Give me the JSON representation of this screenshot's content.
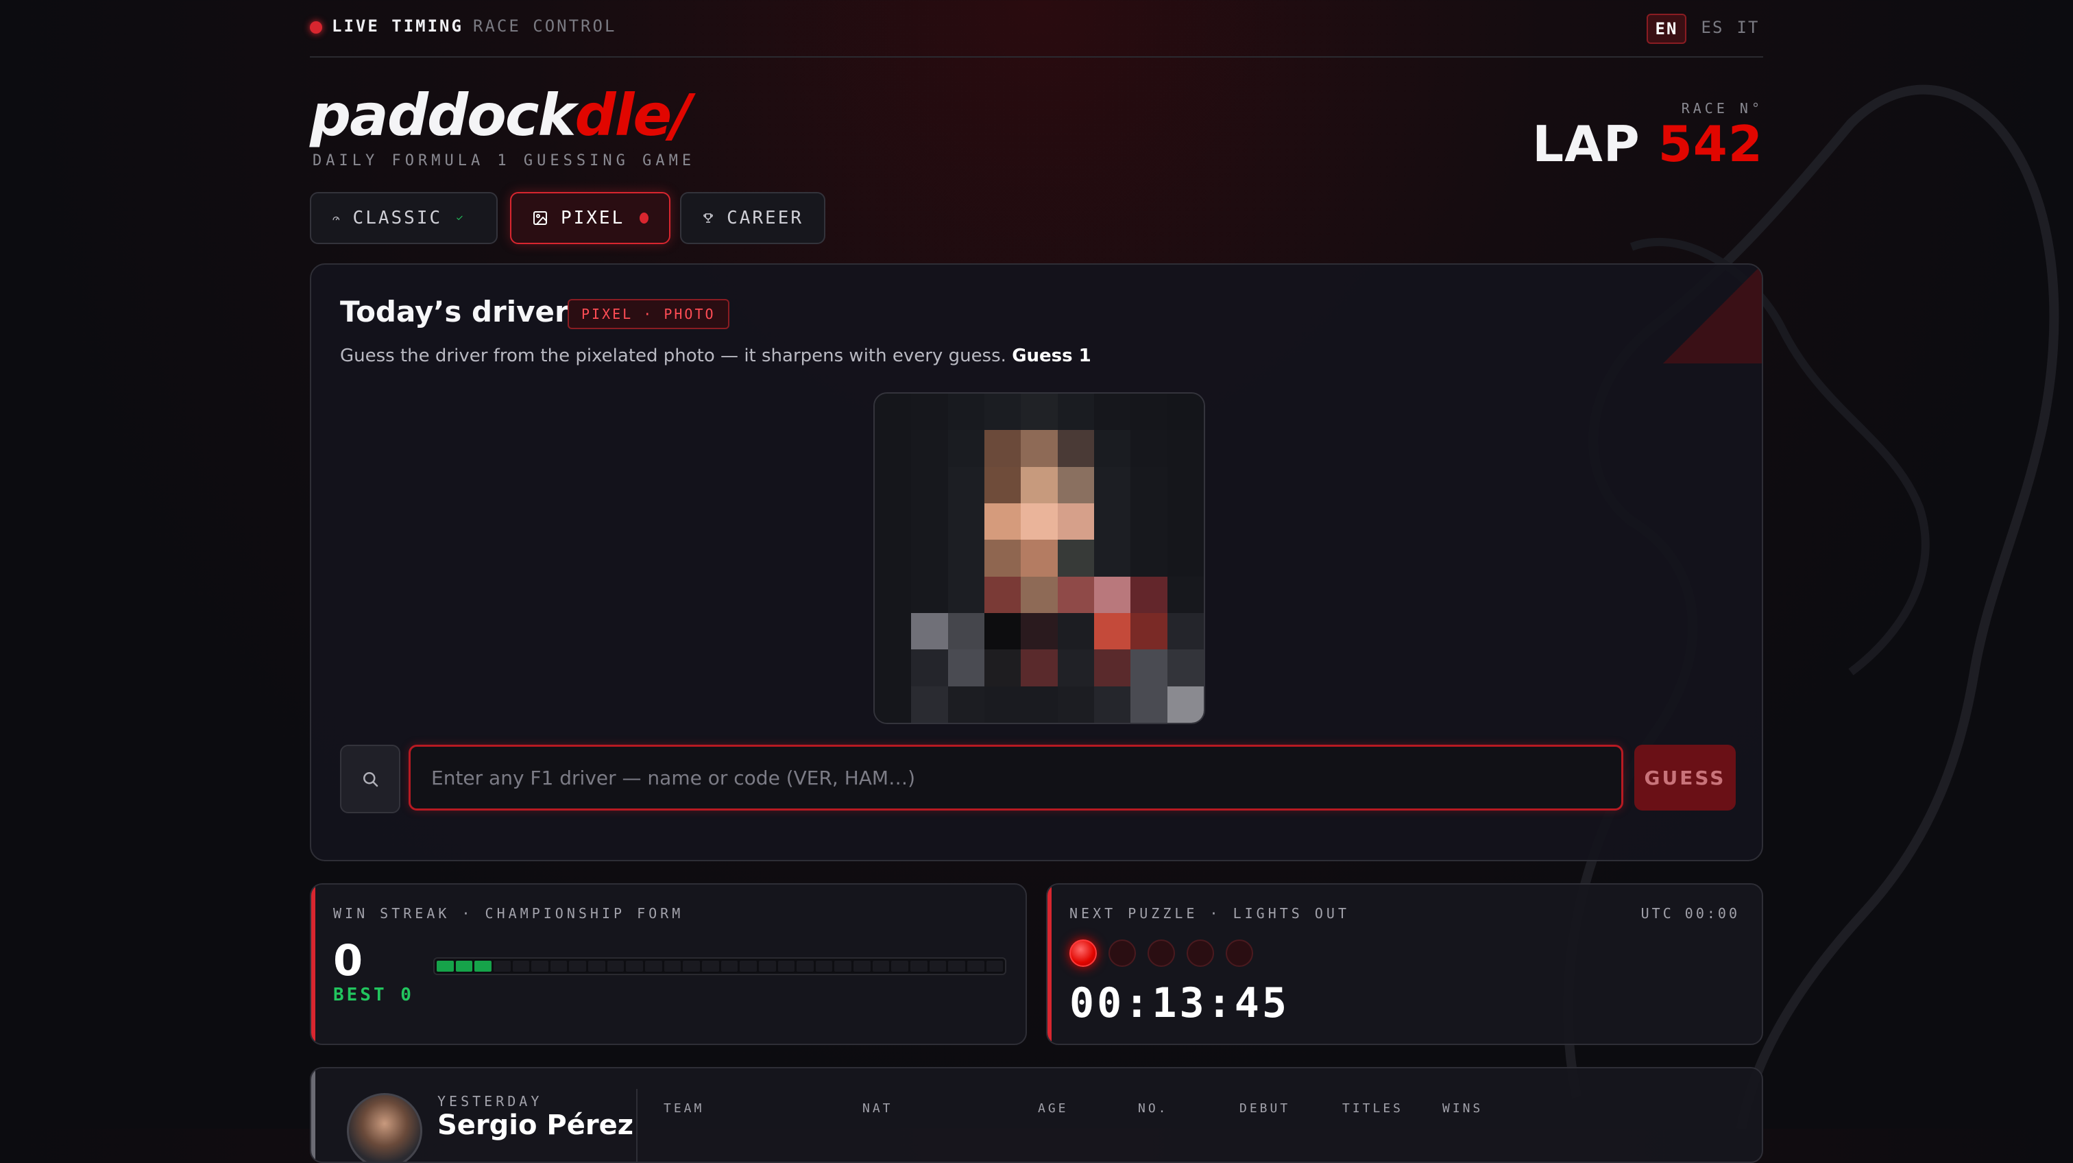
{
  "topbar": {
    "live_label": "LIVE TIMING",
    "race_control_label": "RACE CONTROL",
    "languages": [
      {
        "code": "EN",
        "active": true
      },
      {
        "code": "ES",
        "active": false
      },
      {
        "code": "IT",
        "active": false
      }
    ]
  },
  "header": {
    "logo_main": "paddock",
    "logo_accent": "dle",
    "logo_mark": "/",
    "tagline": "DAILY FORMULA 1 GUESSING GAME",
    "race_label": "RACE N°",
    "lap_label": "LAP",
    "lap_number": "542"
  },
  "tabs": [
    {
      "label": "CLASSIC",
      "icon": "speedometer-icon",
      "status": "completed"
    },
    {
      "label": "PIXEL",
      "icon": "image-icon",
      "status": "active"
    },
    {
      "label": "CAREER",
      "icon": "trophy-icon",
      "status": "idle"
    }
  ],
  "puzzle": {
    "title": "Today’s driver",
    "badge": "PIXEL · PHOTO",
    "description": "Guess the driver from the pixelated photo — it sharpens with every guess.",
    "guess_counter": "Guess 1",
    "input_placeholder": "Enter any F1 driver — name or code (VER, HAM…)",
    "guess_button": "GUESS"
  },
  "streak": {
    "label": "WIN STREAK · CHAMPIONSHIP FORM",
    "value": "0",
    "best": "BEST 0",
    "form_segments_total": 30,
    "form_segments_filled": 3
  },
  "next_puzzle": {
    "label": "NEXT PUZZLE · LIGHTS OUT",
    "utc": "UTC 00:00",
    "lights_total": 5,
    "lights_on": 1,
    "countdown": "00:13:45"
  },
  "yesterday": {
    "label": "YESTERDAY",
    "driver_name": "Sergio Pérez",
    "columns": [
      "TEAM",
      "NAT",
      "AGE",
      "NO.",
      "DEBUT",
      "TITLES",
      "WINS"
    ]
  },
  "colors": {
    "accent": "#e10600",
    "success": "#16a34a"
  }
}
